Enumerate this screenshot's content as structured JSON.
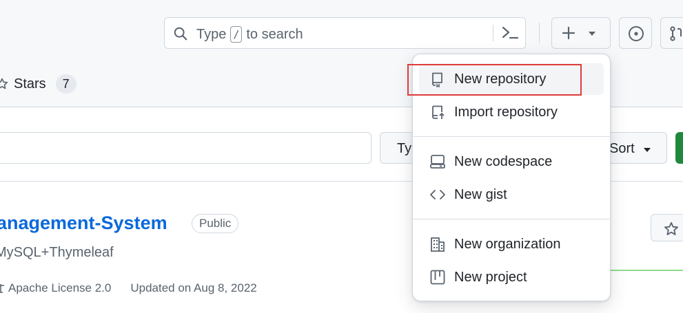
{
  "header": {
    "search": {
      "placeholder_prefix": "Type",
      "shortcut_key": "/",
      "placeholder_suffix": "to search"
    },
    "stars_tab": {
      "label": "Stars",
      "count": "7"
    }
  },
  "filters": {
    "type_label": "Ty",
    "sort_label": "Sort"
  },
  "repo": {
    "name": "anagement-System",
    "visibility": "Public",
    "description": "MySQL+Thymeleaf",
    "license": "Apache License 2.0",
    "updated": "Updated on Aug 8, 2022"
  },
  "create_menu": {
    "items": [
      {
        "label": "New repository",
        "icon": "repo-icon"
      },
      {
        "label": "Import repository",
        "icon": "repo-push-icon"
      },
      {
        "label": "New codespace",
        "icon": "codespace-icon"
      },
      {
        "label": "New gist",
        "icon": "code-icon"
      },
      {
        "label": "New organization",
        "icon": "organization-icon"
      },
      {
        "label": "New project",
        "icon": "project-icon"
      }
    ]
  },
  "colors": {
    "link": "#0969da",
    "highlight": "#e03a3a",
    "primary_button": "#1f883d"
  }
}
